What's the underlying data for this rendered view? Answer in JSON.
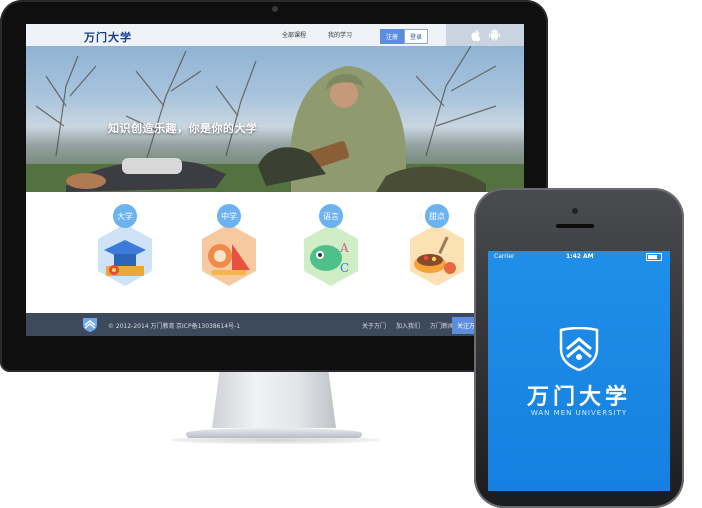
{
  "site": {
    "logo": "万门大学",
    "nav": [
      "全部课程",
      "我的学习"
    ],
    "auth": {
      "register": "注册",
      "login": "登录"
    },
    "platform_icons": [
      "apple-icon",
      "android-icon"
    ],
    "banner_slogan": "知识创造乐趣，你是你的大学",
    "carousel_active_index": 0,
    "carousel_count": 8,
    "categories": [
      {
        "label": "大学",
        "icon": "graduation-cap-icon"
      },
      {
        "label": "中学",
        "icon": "stationery-icon"
      },
      {
        "label": "语言",
        "icon": "language-icon"
      },
      {
        "label": "甜点",
        "icon": "dessert-icon"
      }
    ],
    "footer": {
      "copyright": "© 2012-2014 万门教育",
      "icp": "京ICP备13038614号-1",
      "links": [
        "关于万门",
        "加入我们",
        "万门新闻"
      ],
      "follow": "关注万门"
    }
  },
  "phone": {
    "carrier": "Carrier",
    "time": "1:42 AM",
    "app_name": "万门大学",
    "app_subtitle": "WAN MEN UNIVERSITY"
  },
  "colors": {
    "accent": "#5b8fde",
    "phone_bg": "#1680e0",
    "footer_bg": "#3d4a5c",
    "logo_blue": "#163d8a"
  }
}
